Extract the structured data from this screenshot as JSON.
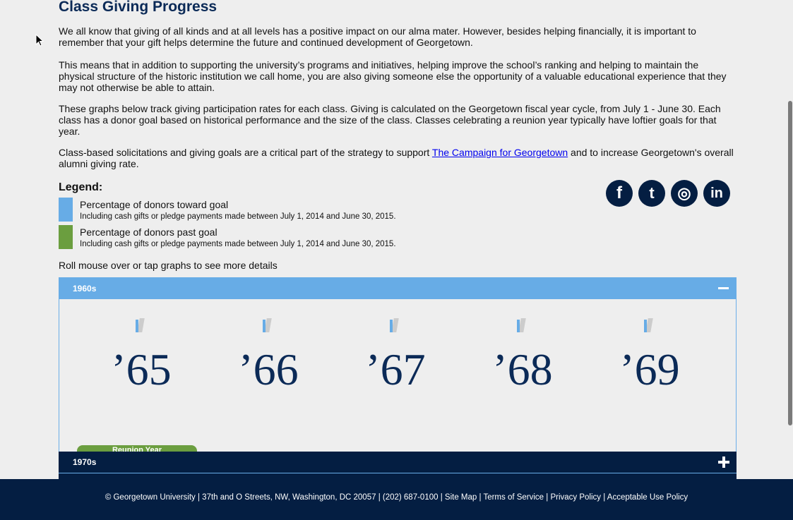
{
  "page": {
    "title": "Class Giving Progress",
    "paragraphs": [
      "We all know that giving of all kinds and at all levels has a positive impact on our alma mater.  However, besides helping financially, it is important to remember that your gift helps determine the future and continued development of Georgetown.",
      "This means that in addition to supporting the university’s programs and initiatives, helping improve the school’s ranking and helping to maintain the physical structure of the historic institution we call home, you are also giving someone else the opportunity of a valuable educational experience that they may not otherwise be able to attain.",
      "These graphs below track giving participation rates for each class. Giving is calculated on the Georgetown fiscal year cycle, from July 1 - June 30. Each class has a donor goal based on historical performance and the size of the class. Classes celebrating a reunion year typically have loftier goals for that year."
    ],
    "campaign_para": {
      "before": "Class-based solicitations and giving goals are a critical part of the strategy to support ",
      "link": "The Campaign for Georgetown",
      "after": " and to increase Georgetown's overall alumni giving rate."
    },
    "rollover_hint": "Roll mouse over or tap graphs to see more details"
  },
  "legend": {
    "title": "Legend:",
    "items": [
      {
        "label": "Percentage of donors toward goal",
        "sub": "Including cash gifts or pledge payments made between July 1, 2014 and June 30, 2015.",
        "color": "#67ace6"
      },
      {
        "label": "Percentage of donors past goal",
        "sub": "Including cash gifts or pledge payments made between July 1, 2014 and June 30, 2015.",
        "color": "#6b9e3f"
      }
    ]
  },
  "social": {
    "icons": [
      {
        "name": "facebook-icon",
        "glyph": "f"
      },
      {
        "name": "twitter-icon",
        "glyph": "t"
      },
      {
        "name": "instagram-icon",
        "glyph": "◎"
      },
      {
        "name": "linkedin-icon",
        "glyph": "in"
      }
    ]
  },
  "decades": [
    {
      "label": "1960s",
      "expanded": true,
      "classes": [
        {
          "year": "’65"
        },
        {
          "year": "’66"
        },
        {
          "year": "’67"
        },
        {
          "year": "’68"
        },
        {
          "year": "’69"
        }
      ],
      "reunion_label": "Reunion Year"
    },
    {
      "label": "1970s",
      "expanded": false
    }
  ],
  "footer": {
    "text": "© Georgetown University | 37th and O Streets, NW, Washington, DC 20057 | (202) 687-0100 | Site Map | Terms of Service | Privacy Policy | Acceptable Use Policy"
  },
  "colors": {
    "navy": "#041e42",
    "title": "#0b2a57",
    "blue": "#67ace6",
    "green": "#6b9e3f"
  }
}
